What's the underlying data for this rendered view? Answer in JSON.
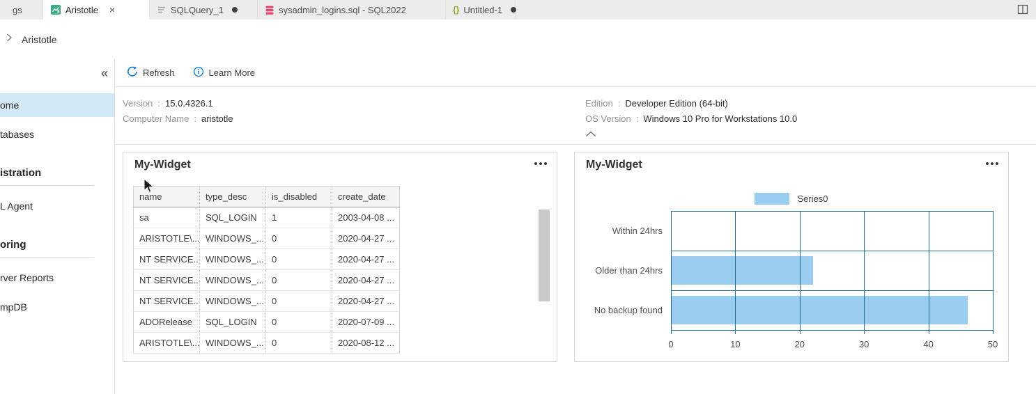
{
  "titlebar": {
    "tabs": [
      {
        "label": "gs",
        "active": false,
        "dirty": false
      },
      {
        "label": "Aristotle",
        "active": true,
        "dirty": false
      },
      {
        "label": "SQLQuery_1",
        "active": false,
        "dirty": true
      },
      {
        "label": "sysadmin_logins.sql - SQL2022",
        "active": false,
        "dirty": false
      },
      {
        "label": "Untitled-1",
        "active": false,
        "dirty": true
      }
    ],
    "close_glyph": "×",
    "braces_glyph": "{}"
  },
  "breadcrumb": {
    "current": "Aristotle"
  },
  "sidebar": {
    "collapse_glyph": "«",
    "items": [
      {
        "label": "ome",
        "selected": true
      },
      {
        "label": "tabases",
        "selected": false
      },
      {
        "label": "istration",
        "header": true
      },
      {
        "label": "L Agent",
        "selected": false
      },
      {
        "label": "oring",
        "header": true
      },
      {
        "label": "rver Reports",
        "selected": false
      },
      {
        "label": "mpDB",
        "selected": false
      }
    ]
  },
  "toolbar": {
    "refresh": "Refresh",
    "learn_more": "Learn More"
  },
  "properties": {
    "sep": ":",
    "left": [
      {
        "label": "Version",
        "value": "15.0.4326.1"
      },
      {
        "label": "Computer Name",
        "value": "aristotle"
      }
    ],
    "right": [
      {
        "label": "Edition",
        "value": "Developer Edition (64-bit)"
      },
      {
        "label": "OS Version",
        "value": "Windows 10 Pro for Workstations 10.0"
      }
    ]
  },
  "widgets": [
    {
      "title": "My-Widget",
      "table": {
        "columns": [
          "name",
          "type_desc",
          "is_disabled",
          "create_date"
        ],
        "rows": [
          [
            "sa",
            "SQL_LOGIN",
            "1",
            "2003-04-08 ..."
          ],
          [
            "ARISTOTLE\\...",
            "WINDOWS_...",
            "0",
            "2020-04-27 ..."
          ],
          [
            "NT SERVICE...",
            "WINDOWS_...",
            "0",
            "2020-04-27 ..."
          ],
          [
            "NT SERVICE...",
            "WINDOWS_...",
            "0",
            "2020-04-27 ..."
          ],
          [
            "NT SERVICE...",
            "WINDOWS_...",
            "0",
            "2020-04-27 ..."
          ],
          [
            "ADORelease",
            "SQL_LOGIN",
            "0",
            "2020-07-09 ..."
          ],
          [
            "ARISTOTLE\\...",
            "WINDOWS_...",
            "0",
            "2020-08-12 ..."
          ]
        ]
      }
    },
    {
      "title": "My-Widget"
    }
  ],
  "chart_data": {
    "type": "bar",
    "orientation": "horizontal",
    "categories": [
      "Within 24hrs",
      "Older than 24hrs",
      "No backup found"
    ],
    "series": [
      {
        "name": "Series0",
        "values": [
          0,
          22,
          46
        ]
      }
    ],
    "xlim": [
      0,
      50
    ],
    "xticks": [
      0,
      10,
      20,
      30,
      40,
      50
    ],
    "grid": true,
    "legend_position": "top",
    "colors": {
      "bar_fill": "#9bcdf0",
      "grid": "#1e6c8b"
    }
  },
  "colors": {
    "accent_blue": "#1583d7",
    "selected_nav_bg": "#d4e9f8"
  }
}
